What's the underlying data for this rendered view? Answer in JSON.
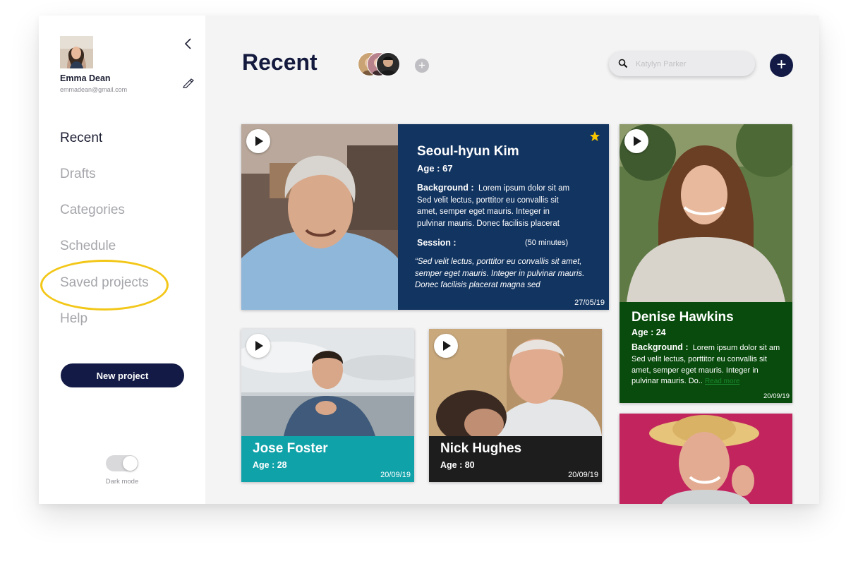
{
  "colors": {
    "navy": "#121a45",
    "card_blue": "#123461",
    "card_green": "#084b0c",
    "card_teal": "#10a2a9",
    "card_dark": "#1d1d1e",
    "card_pink": "#c2255e",
    "highlight": "#f3c718",
    "star": "#f7c500"
  },
  "user": {
    "name": "Emma Dean",
    "email": "emmadean@gmail.com"
  },
  "sidebar": {
    "nav": [
      {
        "label": "Recent",
        "active": true
      },
      {
        "label": "Drafts",
        "active": false
      },
      {
        "label": "Categories",
        "active": false
      },
      {
        "label": "Schedule",
        "active": false
      },
      {
        "label": "Saved projects",
        "active": false,
        "highlighted": true
      },
      {
        "label": "Help",
        "active": false
      }
    ],
    "new_project_label": "New project",
    "dark_mode_label": "Dark mode"
  },
  "header": {
    "title": "Recent",
    "add_collaborator": "+",
    "search_placeholder": "Katylyn Parker",
    "add_button": "+"
  },
  "cards": {
    "featured": {
      "name": "Seoul-hyun Kim",
      "age": "Age : 67",
      "background_label": "Background :",
      "background_text": "Lorem ipsum dolor sit am Sed velit lectus, porttitor eu convallis sit amet, semper eget mauris. Integer in pulvinar mauris. Donec facilisis placerat",
      "session_label": "Session :",
      "session_duration": "(50 minutes)",
      "quote": "“Sed velit lectus, porttitor eu convallis sit amet, semper eget mauris. Integer in pulvinar mauris. Donec facilisis placerat magna sed",
      "date": "27/05/19",
      "starred": true
    },
    "denise": {
      "name": "Denise Hawkins",
      "age": "Age : 24",
      "background_label": "Background :",
      "background_text": "Lorem ipsum dolor sit am Sed velit lectus, porttitor eu convallis sit amet, semper eget mauris. Integer in pulvinar mauris. Do..",
      "read_more": "Read more",
      "date": "20/09/19"
    },
    "jose": {
      "name": "Jose Foster",
      "age": "Age : 28",
      "date": "20/09/19"
    },
    "nick": {
      "name": "Nick Hughes",
      "age": "Age : 80",
      "date": "20/09/19"
    }
  }
}
